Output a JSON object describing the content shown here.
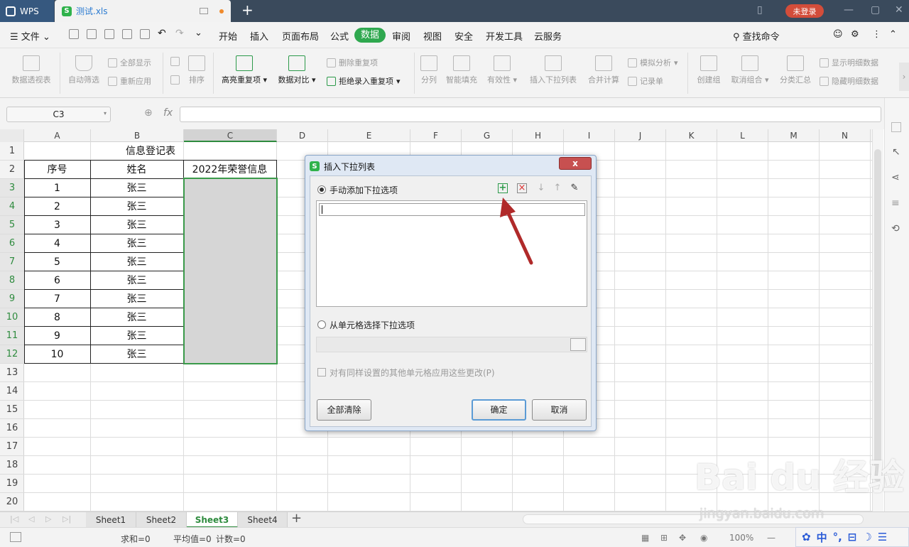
{
  "titlebar": {
    "app_label": "WPS",
    "file_name": "测试.xls",
    "login_label": "未登录"
  },
  "menubar": {
    "file_label": "文件",
    "items": [
      "开始",
      "插入",
      "页面布局",
      "公式",
      "数据",
      "审阅",
      "视图",
      "安全",
      "开发工具",
      "云服务"
    ],
    "active": "数据",
    "search_label": "查找命令"
  },
  "ribbon": {
    "pivot": "数据透视表",
    "autofilter": "自动筛选",
    "show_all": "全部显示",
    "reapply": "重新应用",
    "sort": "排序",
    "highlight_dup": "高亮重复项",
    "compare": "数据对比",
    "remove_dup": "删除重复项",
    "reject_dup": "拒绝录入重复项",
    "split": "分列",
    "smartfill": "智能填充",
    "validity": "有效性",
    "insert_dropdown": "插入下拉列表",
    "consolidate": "合并计算",
    "simulate": "模拟分析",
    "record": "记录单",
    "create_group": "创建组",
    "ungroup": "取消组合",
    "subtotal": "分类汇总",
    "show_detail": "显示明细数据",
    "hide_detail": "隐藏明细数据"
  },
  "formulabar": {
    "namebox": "C3",
    "fx": "fx",
    "formula": ""
  },
  "columns": [
    "A",
    "B",
    "C",
    "D",
    "E",
    "F",
    "G",
    "H",
    "I",
    "J",
    "K",
    "L",
    "M",
    "N"
  ],
  "rows": [
    "1",
    "2",
    "3",
    "4",
    "5",
    "6",
    "7",
    "8",
    "9",
    "10",
    "11",
    "12",
    "13",
    "14",
    "15",
    "16",
    "17",
    "18",
    "19",
    "20"
  ],
  "sheet_table": {
    "title": "信息登记表",
    "headers": [
      "序号",
      "姓名",
      "2022年荣誉信息"
    ],
    "rows": [
      [
        "1",
        "张三",
        ""
      ],
      [
        "2",
        "张三",
        ""
      ],
      [
        "3",
        "张三",
        ""
      ],
      [
        "4",
        "张三",
        ""
      ],
      [
        "5",
        "张三",
        ""
      ],
      [
        "6",
        "张三",
        ""
      ],
      [
        "7",
        "张三",
        ""
      ],
      [
        "8",
        "张三",
        ""
      ],
      [
        "9",
        "张三",
        ""
      ],
      [
        "10",
        "张三",
        ""
      ]
    ]
  },
  "sheet_tabs": [
    "Sheet1",
    "Sheet2",
    "Sheet3",
    "Sheet4"
  ],
  "active_sheet": "Sheet3",
  "statusbar": {
    "sum": "求和=0",
    "avg": "平均值=0",
    "count": "计数=0",
    "zoom": "100%"
  },
  "ime": {
    "lang": "中"
  },
  "dialog": {
    "title": "插入下拉列表",
    "close": "x",
    "option_manual": "手动添加下拉选项",
    "option_cells": "从单元格选择下拉选项",
    "apply_same": "对有同样设置的其他单元格应用这些更改(P)",
    "clear_all": "全部清除",
    "ok": "确定",
    "cancel": "取消"
  },
  "watermark": {
    "main": "Bai du 经验",
    "sub": "jingyan.baidu.com"
  },
  "colors": {
    "accent": "#2fa84f",
    "titlebar": "#3a4a5c",
    "login": "#d34d3a",
    "arrow": "#b02a2a"
  }
}
